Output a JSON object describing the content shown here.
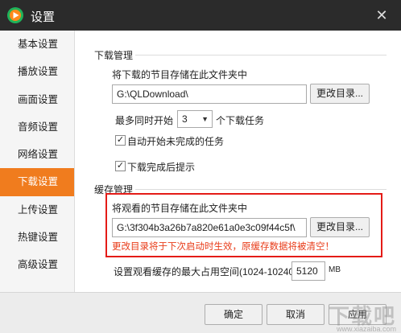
{
  "window": {
    "title": "设置",
    "close_glyph": "✕"
  },
  "sidebar": {
    "items": [
      {
        "label": "基本设置"
      },
      {
        "label": "播放设置"
      },
      {
        "label": "画面设置"
      },
      {
        "label": "音频设置"
      },
      {
        "label": "网络设置"
      },
      {
        "label": "下载设置",
        "active": true
      },
      {
        "label": "上传设置"
      },
      {
        "label": "热键设置"
      },
      {
        "label": "高级设置"
      }
    ]
  },
  "download": {
    "section_title": "下载管理",
    "folder_label": "将下载的节目存储在此文件夹中",
    "folder_path": "G:\\QLDownload\\",
    "change_dir_button": "更改目录...",
    "max_concurrent_prefix": "最多同时开始",
    "max_concurrent_value": "3",
    "max_concurrent_suffix": "个下载任务",
    "auto_start_label": "自动开始未完成的任务",
    "auto_start_checked": true,
    "notify_label": "下载完成后提示",
    "notify_checked": true
  },
  "cache": {
    "section_title": "缓存管理",
    "folder_label": "将观看的节目存储在此文件夹中",
    "folder_path": "G:\\3f304b3a26b7a820e61a0e3c09f44c5f\\",
    "change_dir_button": "更改目录...",
    "warning": "更改目录将于下次启动时生效，原缓存数据将被清空！",
    "max_space_label": "设置观看缓存的最大占用空间(1024-10240)",
    "max_space_value": "5120",
    "max_space_unit": "MB"
  },
  "footer": {
    "ok_button": "确定",
    "cancel_button": "取消",
    "apply_button": "应用"
  },
  "watermark": {
    "text": "下载吧",
    "url": "www.xiazaiba.com"
  },
  "colors": {
    "accent": "#f07c1e",
    "warning": "#e83a17",
    "highlight_border": "#e41b17",
    "titlebar": "#2b2b2b"
  }
}
